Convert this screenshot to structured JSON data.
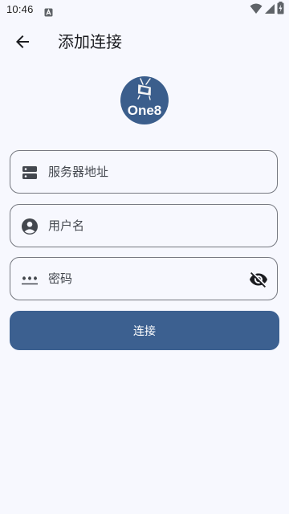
{
  "status_bar": {
    "time": "10:46",
    "icons": [
      "notification-a-icon",
      "wifi-icon",
      "signal-icon",
      "battery-charging-icon"
    ]
  },
  "app_bar": {
    "back_icon": "arrow-back-icon",
    "title": "添加连接"
  },
  "logo": {
    "text": "One8",
    "icon": "tv-logo-icon"
  },
  "form": {
    "server": {
      "icon": "server-icon",
      "placeholder": "服务器地址",
      "value": ""
    },
    "username": {
      "icon": "account-circle-icon",
      "placeholder": "用户名",
      "value": ""
    },
    "password": {
      "icon": "password-dots-icon",
      "placeholder": "密码",
      "value": "",
      "toggle_icon": "visibility-off-icon"
    },
    "connect_label": "连接"
  },
  "colors": {
    "background": "#f7f8fe",
    "primary": "#3c6090",
    "outline": "#74777f",
    "text": "#1b1c20"
  }
}
